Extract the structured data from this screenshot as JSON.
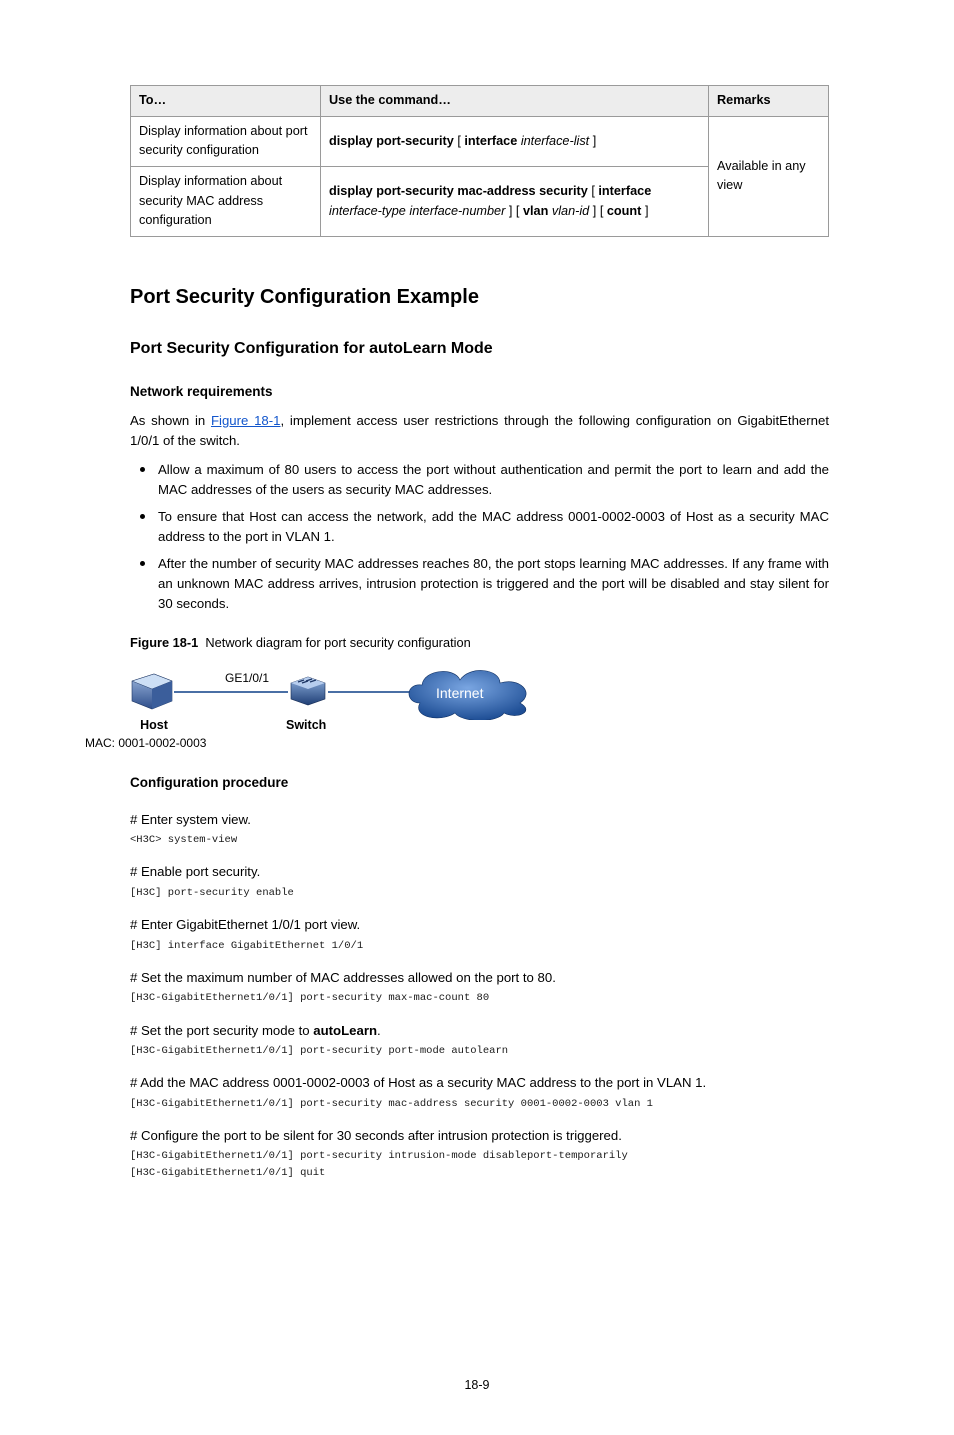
{
  "table": {
    "headers": {
      "to": "To…",
      "use": "Use the command…",
      "remarks": "Remarks"
    },
    "rows": [
      {
        "to": "Display information about port security configuration",
        "cmd_parts": [
          "display port-security ",
          "[ ",
          "interface ",
          "interface-list ",
          "]"
        ]
      },
      {
        "to": "Display information about security MAC address configuration",
        "cmd_parts": [
          "display port-security mac-address security ",
          "[ ",
          "interface ",
          "interface-type interface-number ",
          "] [ ",
          "vlan ",
          "vlan-id ",
          "] [ ",
          "count ",
          "]"
        ]
      }
    ],
    "remarks": "Available in any view"
  },
  "sec_title": "Port Security Configuration Example",
  "sub_title": "Port Security Configuration for autoLearn Mode",
  "nr_title": "Network requirements",
  "nr_para1_pre": "As shown in ",
  "nr_link": "Figure 18-1",
  "nr_para1_post": ", implement access user restrictions through the following configuration on GigabitEthernet 1/0/1 of the switch.",
  "bullets": [
    "Allow a maximum of 80 users to access the port without authentication and permit the port to learn and add the MAC addresses of the users as security MAC addresses.",
    "To ensure that Host can access the network, add the MAC address 0001-0002-0003 of Host as a security MAC address to the port in VLAN 1.",
    "After the number of security MAC addresses reaches 80, the port stops learning MAC addresses. If any frame with an unknown MAC address arrives, intrusion protection is triggered and the port will be disabled and stay silent for 30 seconds."
  ],
  "fig_label": "Figure 18-1",
  "fig_caption": "Network diagram for port security configuration",
  "diagram": {
    "ge": "GE1/0/1",
    "host": "Host",
    "mac": "MAC:   0001-0002-0003",
    "switch": "Switch",
    "internet": "Internet"
  },
  "cfg_title": "Configuration procedure",
  "steps": [
    {
      "text": "# Enter system view.",
      "code": "<H3C> system-view"
    },
    {
      "text": "# Enable port security.",
      "code": "[H3C] port-security enable"
    },
    {
      "text": "# Enter GigabitEthernet 1/0/1 port view.",
      "code": "[H3C] interface GigabitEthernet 1/0/1"
    },
    {
      "text": "# Set the maximum number of MAC addresses allowed on the port to 80.",
      "code": "[H3C-GigabitEthernet1/0/1] port-security max-mac-count 80"
    },
    {
      "text_pre": "# Set the port security mode to ",
      "text_bold": "autoLearn",
      "text_post": ".",
      "code": "[H3C-GigabitEthernet1/0/1] port-security port-mode autolearn"
    },
    {
      "text": "# Add the MAC address 0001-0002-0003 of Host as a security MAC address to the port in VLAN 1.",
      "code": "[H3C-GigabitEthernet1/0/1] port-security mac-address security 0001-0002-0003 vlan 1"
    },
    {
      "text": "# Configure the port to be silent for 30 seconds after intrusion protection is triggered.",
      "code": "[H3C-GigabitEthernet1/0/1] port-security intrusion-mode disableport-temporarily\n[H3C-GigabitEthernet1/0/1] quit"
    }
  ],
  "page_num": "18-9"
}
